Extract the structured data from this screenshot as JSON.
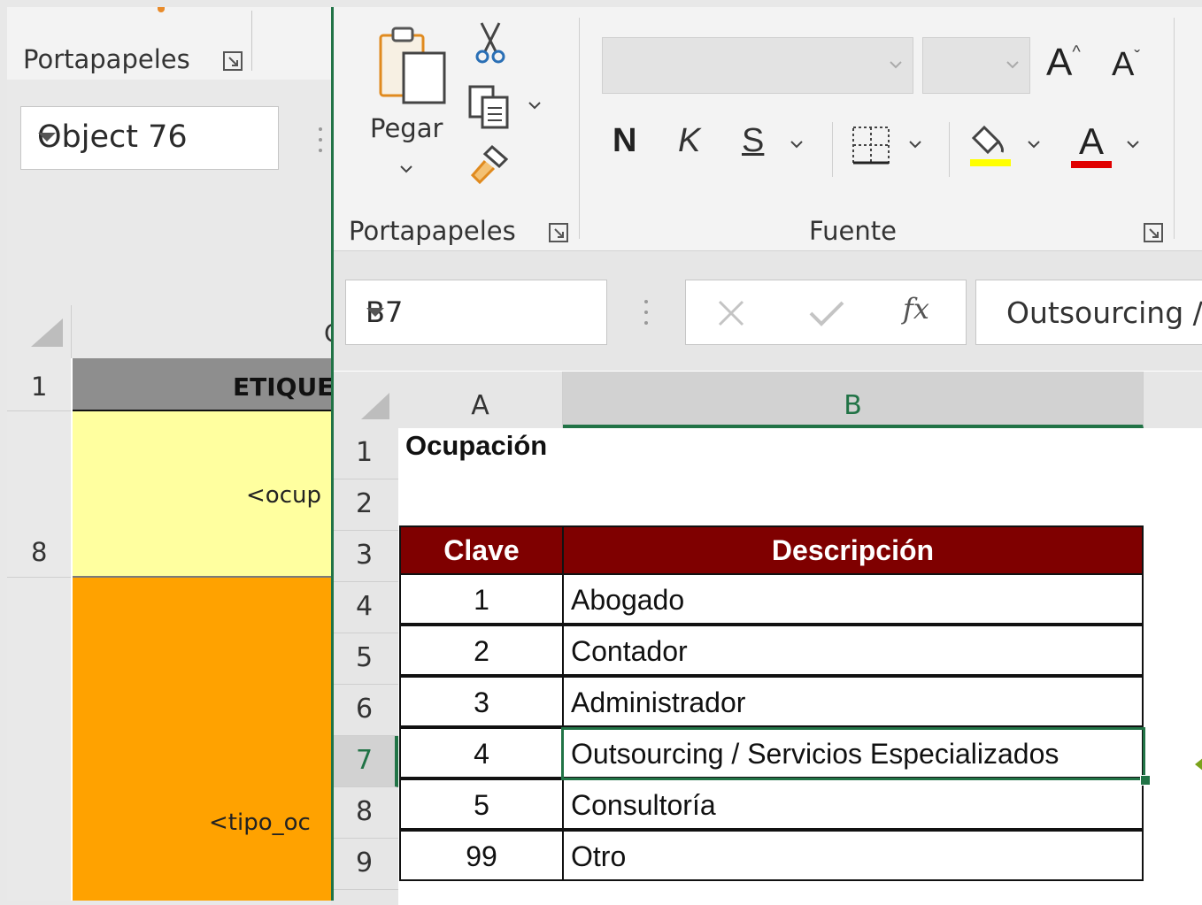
{
  "background_window": {
    "group_label": "Portapapeles",
    "name_box": "Object 76",
    "column_header_partial": "O",
    "rows": [
      {
        "number": "1",
        "text": "ETIQUE"
      },
      {
        "number": "8",
        "text": "<ocup"
      },
      {
        "number": "",
        "text": "<tipo_oc"
      }
    ],
    "colors": {
      "header_fill": "#8e8e8e",
      "row8_fill": "#ffff9f",
      "row9_fill": "#ffa200"
    }
  },
  "ribbon": {
    "paste_label": "Pegar",
    "clipboard_group": "Portapapeles",
    "font_group": "Fuente",
    "font_name": "",
    "font_size": "",
    "bold": "N",
    "italic": "K",
    "underline": "S",
    "grow_font": "A",
    "shrink_font": "A",
    "font_color_glyph": "A",
    "colors": {
      "highlight": "#ffff00",
      "font_color": "#e00000"
    }
  },
  "formula_bar": {
    "name_box": "B7",
    "fx": "fx",
    "content": "Outsourcing / Servicios Especializados"
  },
  "sheet": {
    "columns": [
      "A",
      "B"
    ],
    "row_numbers": [
      "1",
      "2",
      "3",
      "4",
      "5",
      "6",
      "7",
      "8",
      "9"
    ],
    "selected_cell": "B7",
    "title": "Ocupación",
    "table_headers": {
      "clave": "Clave",
      "descripcion": "Descripción"
    },
    "rows": [
      {
        "clave": "1",
        "descripcion": "Abogado"
      },
      {
        "clave": "2",
        "descripcion": "Contador"
      },
      {
        "clave": "3",
        "descripcion": "Administrador"
      },
      {
        "clave": "4",
        "descripcion": "Outsourcing / Servicios Especializados"
      },
      {
        "clave": "5",
        "descripcion": "Consultoría"
      },
      {
        "clave": "99",
        "descripcion": "Otro"
      }
    ],
    "colors": {
      "header_fill": "#7f0000",
      "selection": "#217346"
    }
  }
}
